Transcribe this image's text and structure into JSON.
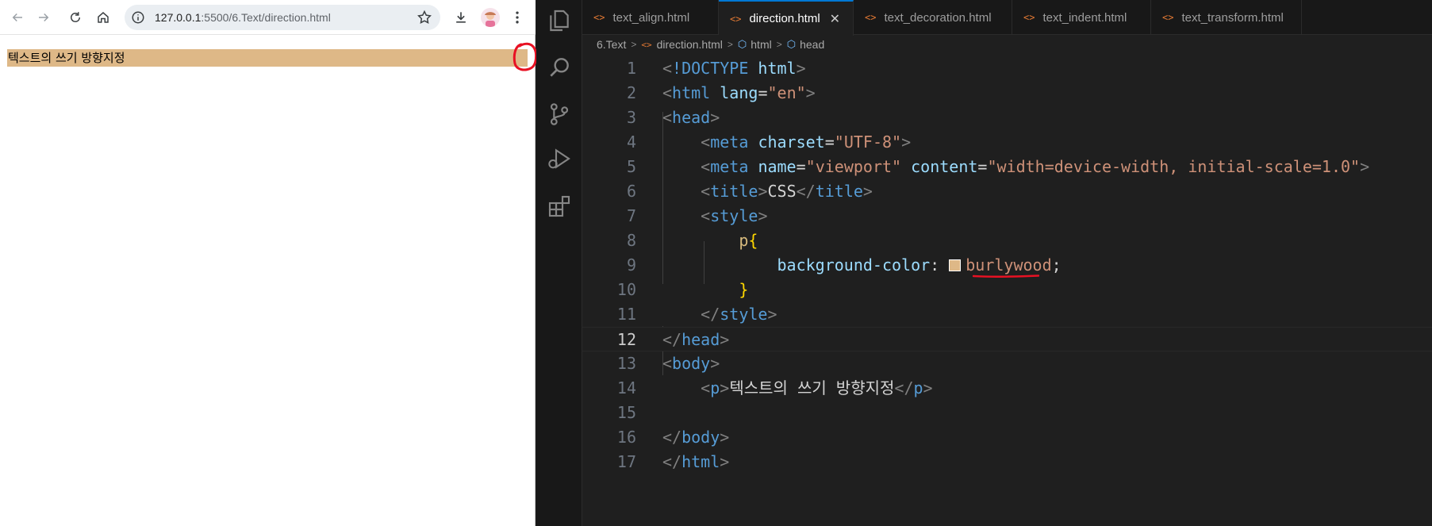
{
  "browser": {
    "url_host": "127.0.0.1",
    "url_path": ":5500/6.Text/direction.html",
    "paragraph_text": "텍스트의 쓰기 방향지정",
    "paragraph_bg": "#deb887"
  },
  "editor": {
    "tabs": [
      {
        "label": "text_align.html",
        "active": false
      },
      {
        "label": "direction.html",
        "active": true
      },
      {
        "label": "text_decoration.html",
        "active": false
      },
      {
        "label": "text_indent.html",
        "active": false
      },
      {
        "label": "text_transform.html",
        "active": false
      }
    ],
    "close_glyph": "✕",
    "breadcrumb": [
      "6.Text",
      "direction.html",
      "html",
      "head"
    ],
    "current_line": "12",
    "line_numbers": [
      "1",
      "2",
      "3",
      "4",
      "5",
      "6",
      "7",
      "8",
      "9",
      "10",
      "11",
      "12",
      "13",
      "14",
      "15",
      "16",
      "17"
    ],
    "code": {
      "l1_doctype": "!DOCTYPE",
      "l1_html": "html",
      "l2_tag": "html",
      "l2_attr": "lang",
      "l2_val": "\"en\"",
      "l3_tag": "head",
      "l4_tag": "meta",
      "l4_attr": "charset",
      "l4_val": "\"UTF-8\"",
      "l5_tag": "meta",
      "l5_attr1": "name",
      "l5_val1": "\"viewport\"",
      "l5_attr2": "content",
      "l5_val2": "\"width=device-width, initial-scale=1.0\"",
      "l6_tag": "title",
      "l6_text": "CSS",
      "l7_tag": "style",
      "l8_sel": "p",
      "l9_prop": "background-color",
      "l9_val": "burlywood",
      "l11_tag": "style",
      "l12_tag": "head",
      "l13_tag": "body",
      "l14_tag": "p",
      "l14_text": "텍스트의 쓰기 방향지정",
      "l16_tag": "body",
      "l17_tag": "html"
    }
  },
  "colors": {
    "accent": "#0078d4",
    "annotation": "#e81123",
    "burlywood": "#deb887"
  }
}
